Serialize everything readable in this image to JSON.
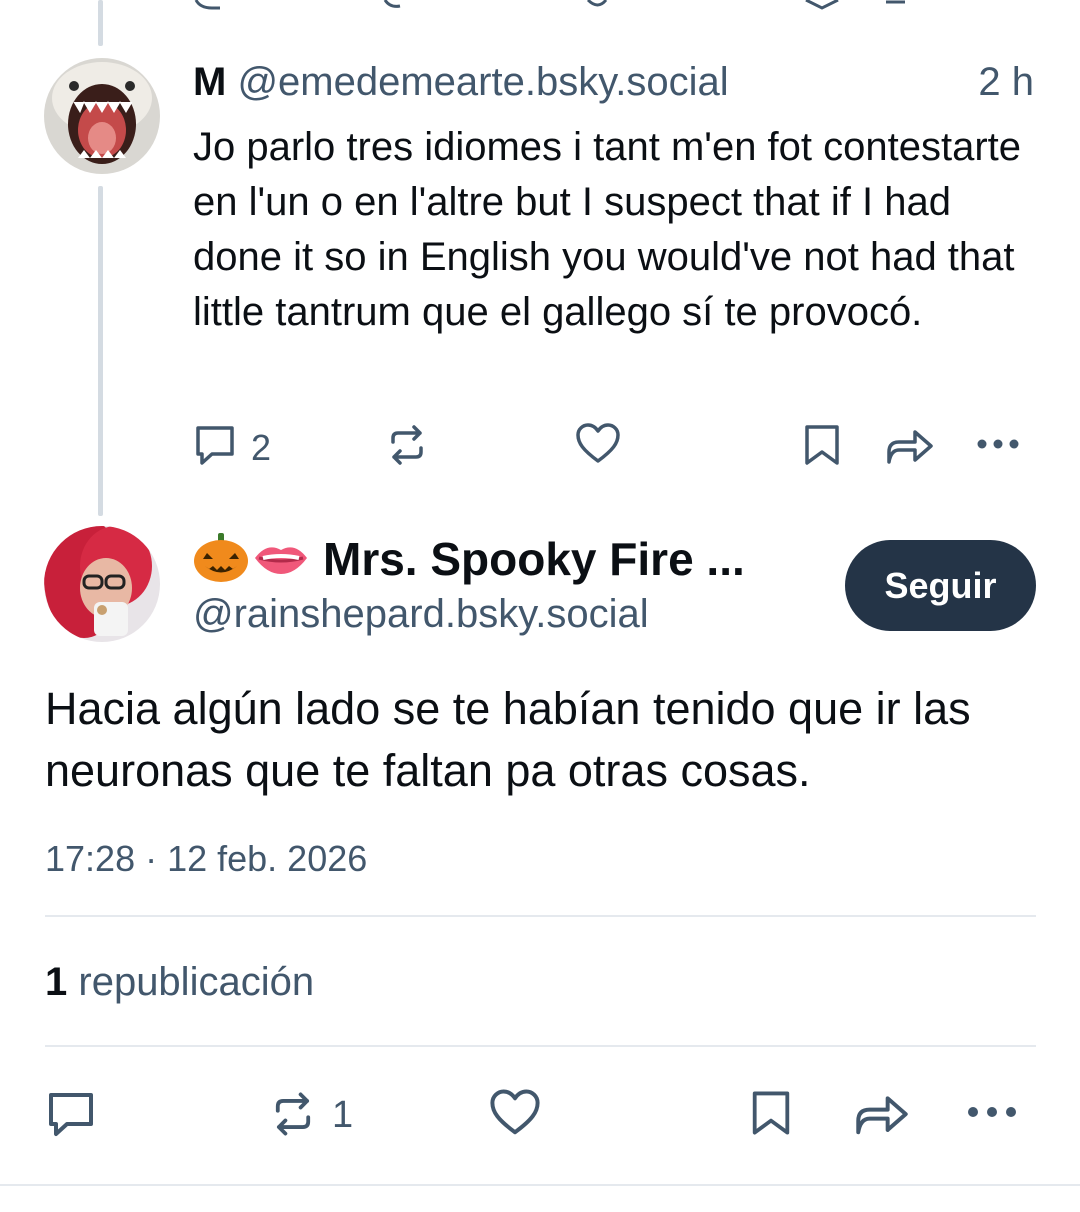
{
  "reply": {
    "display_name": "M",
    "handle": "@emedemearte.bsky.social",
    "time_ago": "2 h",
    "text": "Jo parlo tres idiomes i tant m'en fot contestarte en l'un o en l'altre but I suspect that if I had done it so in English you would've not had that little tantrum que el gallego sí te provocó.",
    "reply_count": "2"
  },
  "main_post": {
    "name_emojis": [
      "jack-o-lantern-icon",
      "lips-icon"
    ],
    "display_name": "Mrs. Spooky Fire ...",
    "handle": "@rainshepard.bsky.social",
    "follow_label": "Seguir",
    "text": "Hacia algún lado se te habían tenido que ir las neuronas que te faltan pa otras cosas.",
    "timestamp": "17:28 · 12 feb. 2026",
    "repost_count": "1",
    "repost_label": "republicación",
    "action_repost_count": "1"
  },
  "colors": {
    "accent_dark": "#243447",
    "muted_text": "#42576c",
    "thread_line": "#d4dbe2"
  }
}
